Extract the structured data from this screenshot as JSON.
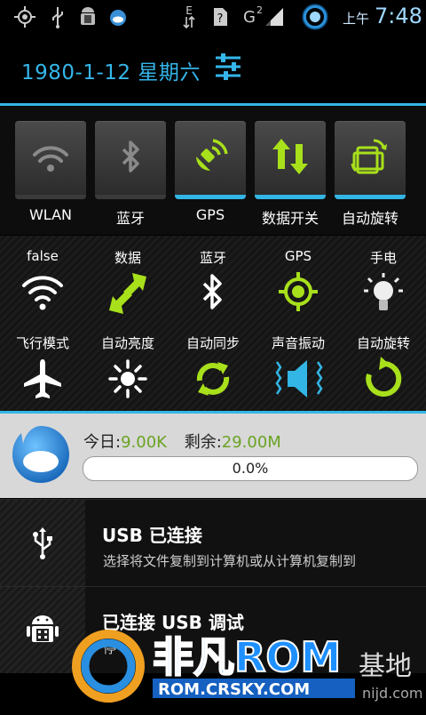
{
  "status_bar": {
    "ampm": "上午",
    "time": "7:48",
    "edge_label": "E",
    "g_label": "G",
    "g_sup": "2"
  },
  "date_row": {
    "date": "1980-1-12 星期六"
  },
  "toggles": [
    {
      "label": "WLAN",
      "on": false,
      "icon": "wifi-icon"
    },
    {
      "label": "蓝牙",
      "on": false,
      "icon": "bluetooth-icon"
    },
    {
      "label": "GPS",
      "on": true,
      "icon": "gps-icon"
    },
    {
      "label": "数据开关",
      "on": true,
      "icon": "data-arrows-icon"
    },
    {
      "label": "自动旋转",
      "on": true,
      "icon": "rotate-icon"
    }
  ],
  "grid": {
    "row1": [
      {
        "label": "false",
        "icon": "wifi-icon"
      },
      {
        "label": "数据",
        "icon": "data-arrows-icon"
      },
      {
        "label": "蓝牙",
        "icon": "bluetooth-icon"
      },
      {
        "label": "GPS",
        "icon": "gps-icon"
      },
      {
        "label": "手电",
        "icon": "flashlight-icon"
      }
    ],
    "row2": [
      {
        "label": "飞行模式",
        "icon": "airplane-icon"
      },
      {
        "label": "自动亮度",
        "icon": "brightness-icon"
      },
      {
        "label": "自动同步",
        "icon": "sync-icon"
      },
      {
        "label": "声音振动",
        "icon": "speaker-vibrate-icon"
      },
      {
        "label": "自动旋转",
        "icon": "rotate-icon"
      }
    ]
  },
  "traffic": {
    "today_label": "今日:",
    "today_value": "9.00K",
    "remain_label": "剩余:",
    "remain_value": "29.00M",
    "progress_fraction": 0.0,
    "progress_text": "0.0%"
  },
  "notifications": [
    {
      "title": "USB 已连接",
      "subtitle": "选择将文件复制到计算机或从计算机复制到",
      "icon": "usb-icon"
    },
    {
      "title": "已连接 USB 调试",
      "subtitle": "停",
      "icon": "android-icon"
    }
  ],
  "watermark": {
    "brand": "非凡ROM",
    "domain": "ROM.CRSKY.COM",
    "suffix": "基地",
    "site": "nijd.com"
  },
  "colors": {
    "accent": "#33b5e5",
    "active_green": "#a8e01b",
    "text_green": "#6aa323"
  }
}
